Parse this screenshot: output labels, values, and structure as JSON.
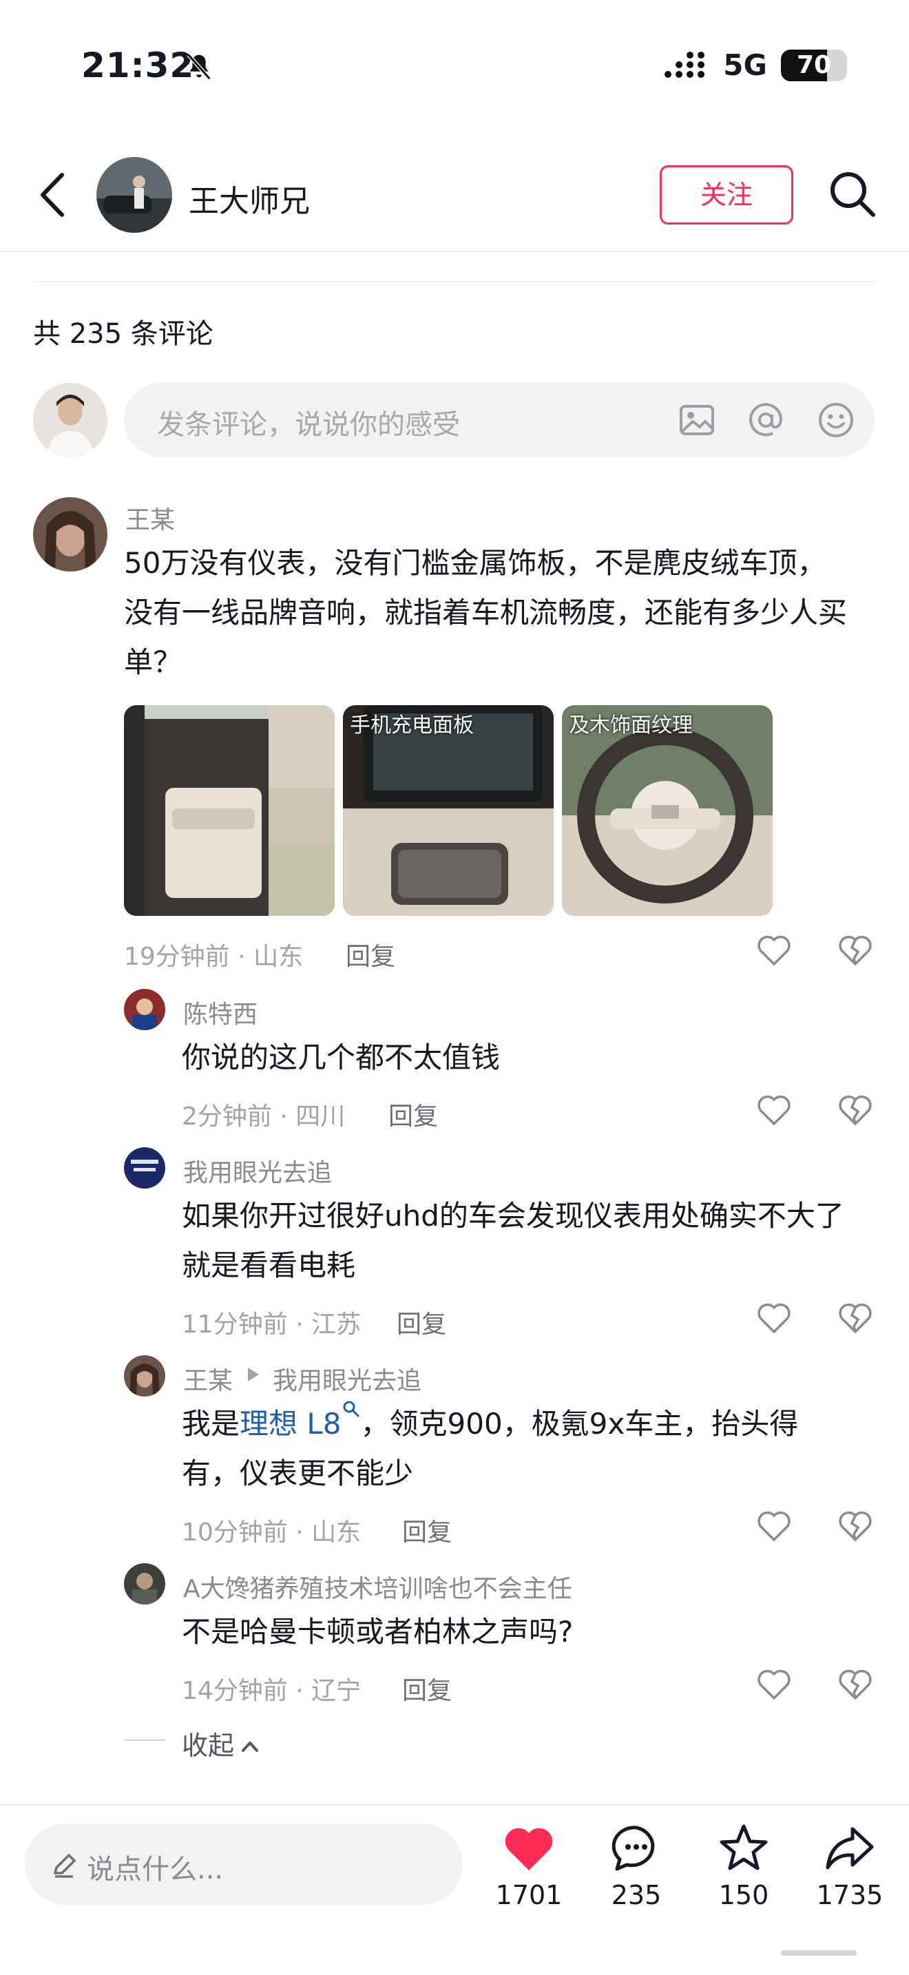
{
  "status_bar": {
    "time": "21:32",
    "network": "5G",
    "battery": "70",
    "battery_level": 0.7
  },
  "header": {
    "username": "王大师兄",
    "follow_label": "关注"
  },
  "comments_count_label": "共 235 条评论",
  "comment_input": {
    "placeholder": "发条评论，说说你的感受"
  },
  "main_comment": {
    "user": "王某",
    "text": "50万没有仪表，没有门槛金属饰板，不是麂皮绒车顶，没有一线品牌音响，就指着车机流畅度，还能有多少人买单？",
    "images": [
      {
        "caption": ""
      },
      {
        "caption": "手机充电面板"
      },
      {
        "caption": "及木饰面纹理"
      }
    ],
    "meta": "19分钟前 · 山东",
    "reply_label": "回复"
  },
  "replies": [
    {
      "user": "陈特西",
      "text": "你说的这几个都不太值钱",
      "meta": "2分钟前 · 四川",
      "reply_label": "回复"
    },
    {
      "user": "我用眼光去追",
      "text_line1": "如果你开过很好uhd的车会发现仪表用处确实不大了",
      "text_line2": "就是看看电耗",
      "meta": "11分钟前 · 江苏",
      "reply_label": "回复"
    },
    {
      "user": "王某",
      "reply_to": "我用眼光去追",
      "text_prefix": "我是",
      "link": "理想 L8",
      "text_suffix": "，领克900，极氪9x车主，抬头得",
      "text_line2": "有，仪表更不能少",
      "meta": "10分钟前 · 山东",
      "reply_label": "回复"
    },
    {
      "user": "A大馋猪养殖技术培训啥也不会主任",
      "text": "不是哈曼卡顿或者柏林之声吗?",
      "meta": "14分钟前 · 辽宁",
      "reply_label": "回复"
    }
  ],
  "collapse_label": "收起",
  "bottom_bar": {
    "input_placeholder": "说点什么...",
    "likes": "1701",
    "comments": "235",
    "favorites": "150",
    "shares": "1735"
  },
  "colors": {
    "accent": "#fe2c55",
    "link": "#1f5fb0",
    "text": "#161823",
    "muted": "#a2a3a8"
  }
}
